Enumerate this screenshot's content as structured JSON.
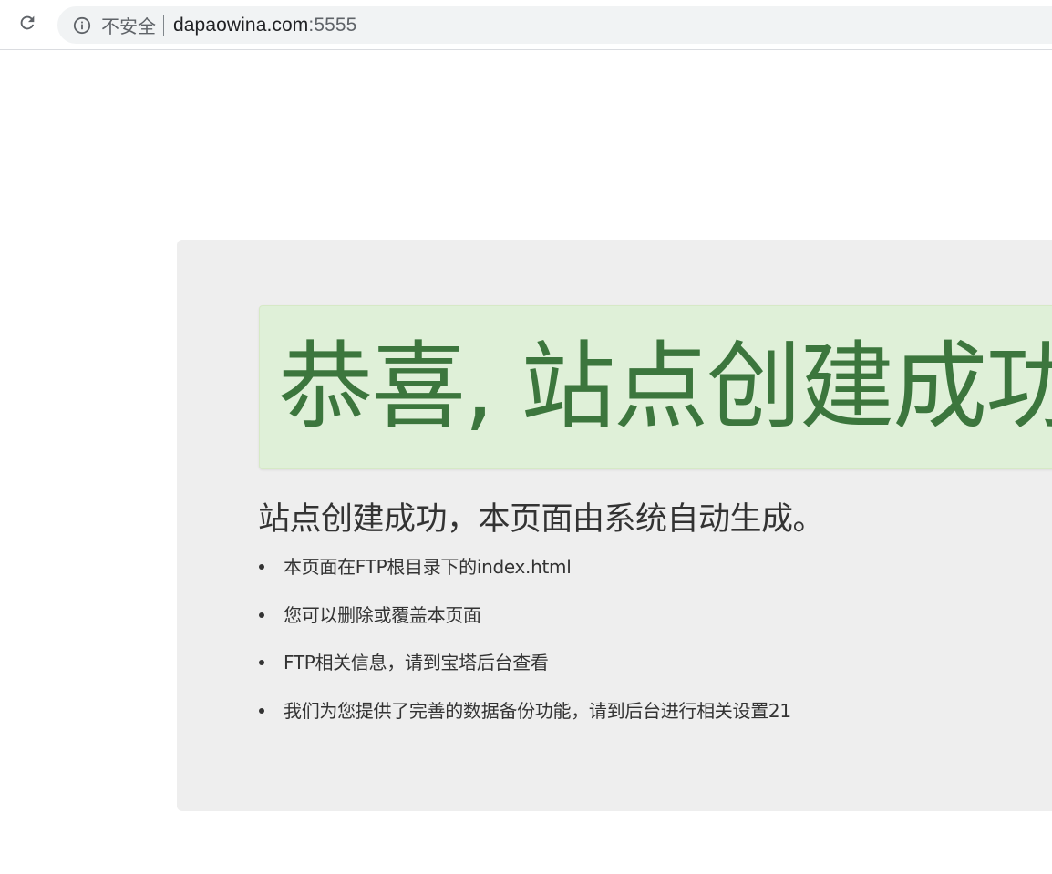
{
  "browser": {
    "reload_icon": "reload-icon",
    "info_icon": "info-icon",
    "security_label": "不安全",
    "url_host": "dapaowina.com",
    "url_port": ":5555"
  },
  "page": {
    "alert_title": "恭喜, 站点创建成功！",
    "subtitle": "站点创建成功，本页面由系统自动生成。",
    "items": [
      "本页面在FTP根目录下的index.html",
      "您可以删除或覆盖本页面",
      "FTP相关信息，请到宝塔后台查看",
      "我们为您提供了完善的数据备份功能，请到后台进行相关设置21"
    ]
  },
  "colors": {
    "alert_background": "#dff0d8",
    "alert_text": "#3c763d",
    "container_background": "#eeeeee",
    "body_text": "#333333"
  }
}
